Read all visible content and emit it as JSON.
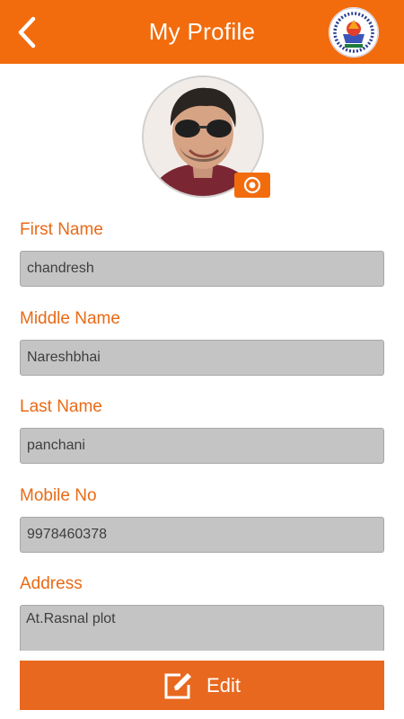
{
  "header": {
    "title": "My Profile",
    "back_icon": "chevron-left-icon",
    "logo_icon": "organization-seal-logo"
  },
  "profile": {
    "avatar": "user-profile-photo",
    "camera_icon": "camera-icon"
  },
  "form": {
    "fields": [
      {
        "label": "First Name",
        "value": "chandresh"
      },
      {
        "label": "Middle Name",
        "value": "Nareshbhai"
      },
      {
        "label": "Last Name",
        "value": "panchani"
      },
      {
        "label": "Mobile No",
        "value": "9978460378"
      },
      {
        "label": "Address",
        "value": "At.Rasnal plot"
      }
    ]
  },
  "actions": {
    "edit_label": "Edit",
    "edit_icon": "edit-pencil-icon"
  },
  "colors": {
    "brand": "#f26c0d",
    "label": "#e86a16",
    "input_bg": "#c4c4c4",
    "button": "#e8681f"
  }
}
